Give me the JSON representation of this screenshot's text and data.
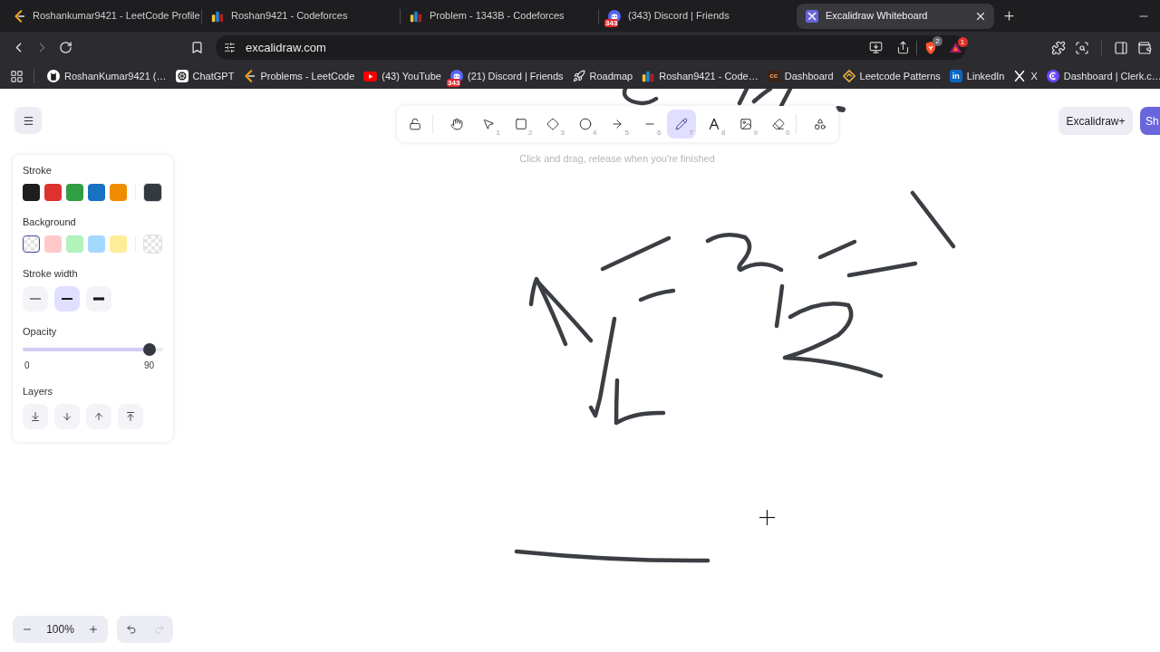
{
  "browser": {
    "tabs": [
      {
        "title": "Roshankumar9421 - LeetCode Profile",
        "kind": "leetcode",
        "selected": false
      },
      {
        "title": "Roshan9421 - Codeforces",
        "kind": "codeforces",
        "selected": false
      },
      {
        "title": "Problem - 1343B - Codeforces",
        "kind": "codeforces",
        "selected": false
      },
      {
        "title": "(343) Discord | Friends",
        "kind": "discord",
        "badge": "343",
        "selected": false
      },
      {
        "title": "Excalidraw Whiteboard",
        "kind": "excalidraw",
        "selected": true
      }
    ],
    "navigation": [
      {
        "kind": "back",
        "disabled": false
      },
      {
        "kind": "forward",
        "disabled": true
      },
      {
        "kind": "reload",
        "disabled": false
      }
    ],
    "address_bar": {
      "url": "excalidraw.com",
      "shields_count": "2",
      "rewards_count": "1"
    },
    "bookmarks": [
      {
        "label": "RoshanKumar9421 (…",
        "kind": "github"
      },
      {
        "label": "ChatGPT",
        "kind": "chatgpt"
      },
      {
        "label": "Problems - LeetCode",
        "kind": "leetcode"
      },
      {
        "label": "(43) YouTube",
        "kind": "youtube"
      },
      {
        "label": "(21) Discord | Friends",
        "kind": "discord",
        "badge": "343"
      },
      {
        "label": "Roadmap",
        "kind": "rocket"
      },
      {
        "label": "Roshan9421 - Code…",
        "kind": "codeforces"
      },
      {
        "label": "Dashboard",
        "kind": "cc",
        "icon_text": "cc"
      },
      {
        "label": "Leetcode Patterns",
        "kind": "patterns"
      },
      {
        "label": "LinkedIn",
        "kind": "linkedin",
        "icon_text": "in"
      },
      {
        "label": "X",
        "kind": "x"
      },
      {
        "label": "Dashboard | Clerk.c…",
        "kind": "clerk"
      }
    ]
  },
  "toolbar": {
    "tools": [
      {
        "kind": "lock",
        "selected": false
      },
      {
        "kind": "hand",
        "selected": false
      },
      {
        "kind": "selection",
        "shortcut": "1",
        "selected": false
      },
      {
        "kind": "rectangle",
        "shortcut": "2",
        "selected": false
      },
      {
        "kind": "diamond",
        "shortcut": "3",
        "selected": false
      },
      {
        "kind": "ellipse",
        "shortcut": "4",
        "selected": false
      },
      {
        "kind": "arrow",
        "shortcut": "5",
        "selected": false
      },
      {
        "kind": "line",
        "shortcut": "6",
        "selected": false
      },
      {
        "kind": "pencil",
        "shortcut": "7",
        "selected": true
      },
      {
        "kind": "text",
        "shortcut": "8",
        "selected": false
      },
      {
        "kind": "image",
        "shortcut": "9",
        "selected": false
      },
      {
        "kind": "eraser",
        "shortcut": "0",
        "selected": false
      },
      {
        "kind": "more_tools",
        "selected": false
      }
    ],
    "hint": "Click and drag, release when you're finished"
  },
  "top_right_buttons": [
    {
      "label": "Excalidraw+",
      "kind": "secondary"
    },
    {
      "label": "Sh",
      "kind": "primary"
    }
  ],
  "properties": {
    "stroke": {
      "label": "Stroke",
      "swatches": [
        {
          "kind": "solid",
          "color": "#1e1e1e",
          "selected": false
        },
        {
          "kind": "solid",
          "color": "#e03131",
          "selected": false
        },
        {
          "kind": "solid",
          "color": "#2f9e44",
          "selected": false
        },
        {
          "kind": "solid",
          "color": "#1971c2",
          "selected": false
        },
        {
          "kind": "solid",
          "color": "#f08c00",
          "selected": false
        }
      ],
      "current": {
        "kind": "solid",
        "color": "#343a40"
      }
    },
    "background": {
      "label": "Background",
      "swatches": [
        {
          "kind": "transparent",
          "selected": true
        },
        {
          "kind": "solid",
          "color": "#ffc9c9",
          "selected": false
        },
        {
          "kind": "solid",
          "color": "#b2f2bb",
          "selected": false
        },
        {
          "kind": "solid",
          "color": "#a5d8ff",
          "selected": false
        },
        {
          "kind": "solid",
          "color": "#ffec99",
          "selected": false
        }
      ],
      "current": {
        "kind": "transparent"
      }
    },
    "stroke_width": {
      "label": "Stroke width",
      "options": [
        {
          "kind": "thin",
          "selected": false
        },
        {
          "kind": "bold",
          "selected": true
        },
        {
          "kind": "extra_bold",
          "selected": false
        }
      ]
    },
    "opacity": {
      "label": "Opacity",
      "level": 0.9,
      "min_label": "0",
      "value_label": "90"
    },
    "layers": {
      "label": "Layers",
      "buttons": [
        {
          "kind": "send_to_back"
        },
        {
          "kind": "send_backward"
        },
        {
          "kind": "bring_forward"
        },
        {
          "kind": "bring_to_front"
        }
      ]
    }
  },
  "zoom_controls": {
    "value": "100%"
  },
  "history": [
    {
      "kind": "undo",
      "disabled": false
    },
    {
      "kind": "redo",
      "disabled": true
    }
  ]
}
